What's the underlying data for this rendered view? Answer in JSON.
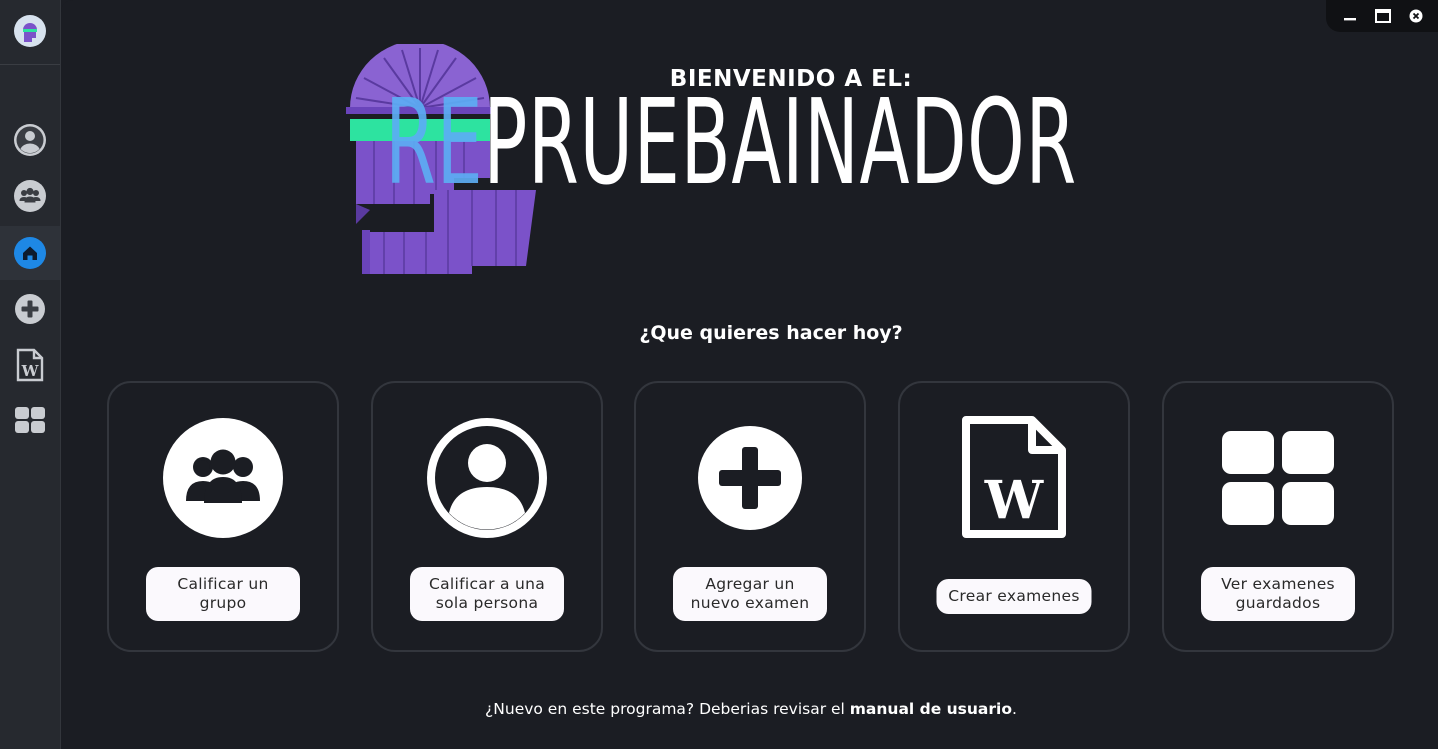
{
  "app": {
    "logo_icon": "repruebainador-logo-icon"
  },
  "sidebar": {
    "items": [
      {
        "id": "profile",
        "icon": "user-icon"
      },
      {
        "id": "group",
        "icon": "group-icon"
      },
      {
        "id": "home",
        "icon": "home-icon",
        "active": true
      },
      {
        "id": "add",
        "icon": "plus-icon"
      },
      {
        "id": "word",
        "icon": "word-document-icon"
      },
      {
        "id": "grid",
        "icon": "grid-icon"
      }
    ]
  },
  "window_controls": [
    "minimize-icon",
    "maximize-icon",
    "close-icon"
  ],
  "hero": {
    "welcome": "BIENVENIDO A EL:",
    "title_prefix": "RE",
    "title_rest": "PRUEBAINADOR"
  },
  "question": "¿Que quieres hacer hoy?",
  "cards": [
    {
      "icon": "group-icon",
      "label": "Calificar un grupo"
    },
    {
      "icon": "user-icon",
      "label": "Calificar a una sola persona"
    },
    {
      "icon": "plus-icon",
      "label": "Agregar un nuevo examen"
    },
    {
      "icon": "word-document-icon",
      "label": "Crear examenes"
    },
    {
      "icon": "grid-icon",
      "label": "Ver examenes guardados"
    }
  ],
  "footer": {
    "text": "¿Nuevo en este programa? Deberias revisar el ",
    "link": "manual de usuario",
    "end": "."
  },
  "colors": {
    "background": "#1b1d23",
    "sidebar": "#26292f",
    "accent_blue": "#5dadf4",
    "active_icon": "#1e88e5",
    "logo_purple": "#7b52c9",
    "logo_green": "#2de3a0"
  }
}
